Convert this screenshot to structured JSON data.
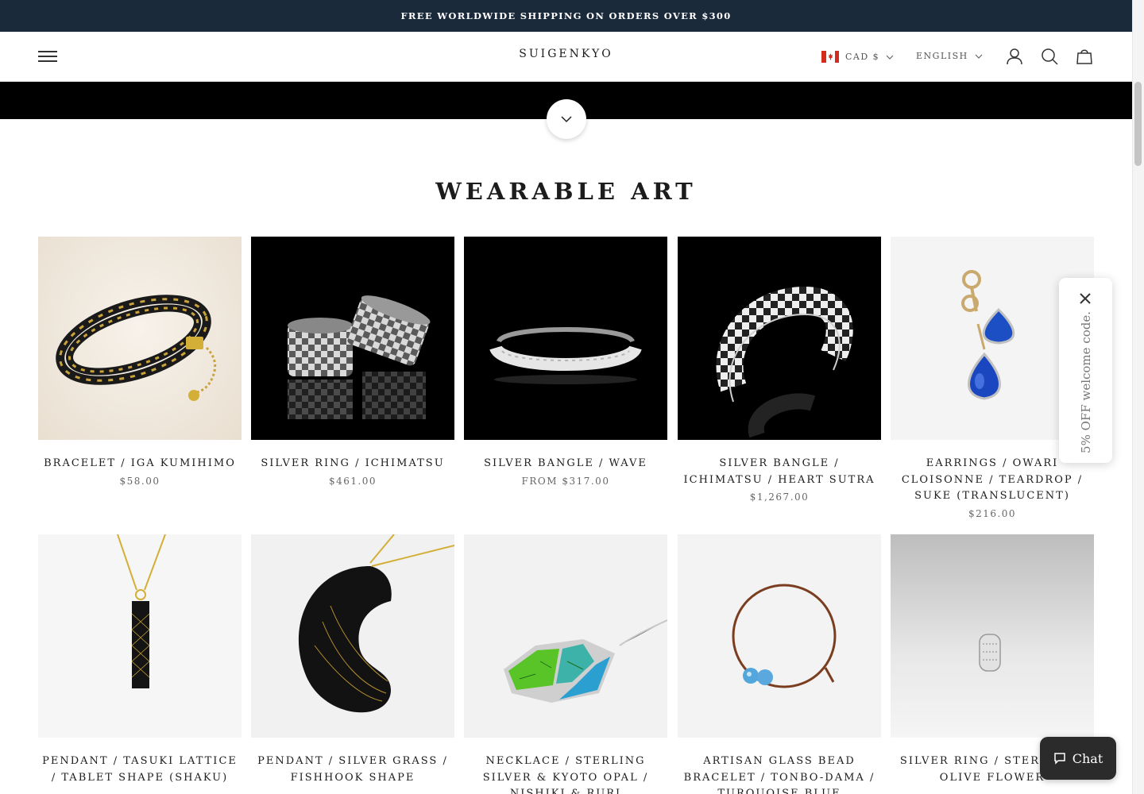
{
  "announcement": "FREE WORLDWIDE SHIPPING ON ORDERS OVER $300",
  "header": {
    "logo": "SUIGENKYO",
    "currency": "CAD $",
    "language": "ENGLISH"
  },
  "section": {
    "title": "WEARABLE ART"
  },
  "products": [
    {
      "title": "BRACELET / IGA KUMIHIMO",
      "price": "$58.00"
    },
    {
      "title": "SILVER RING / ICHIMATSU",
      "price": "$461.00"
    },
    {
      "title": "SILVER BANGLE / WAVE",
      "price": "FROM $317.00"
    },
    {
      "title": "SILVER BANGLE / ICHIMATSU / HEART SUTRA",
      "price": "$1,267.00"
    },
    {
      "title": "EARRINGS / OWARI CLOISONNE / TEARDROP / SUKE (TRANSLUCENT)",
      "price": "$216.00"
    },
    {
      "title": "PENDANT / TASUKI LATTICE / TABLET SHAPE (SHAKU)",
      "price": ""
    },
    {
      "title": "PENDANT / SILVER GRASS / FISHHOOK SHAPE",
      "price": ""
    },
    {
      "title": "NECKLACE / STERLING SILVER & KYOTO OPAL / NISHIKI & RURI",
      "price": ""
    },
    {
      "title": "ARTISAN GLASS BEAD BRACELET / TONBO-DAMA / TURQUOISE BLUE",
      "price": ""
    },
    {
      "title": "SILVER RING / STERLING / OLIVE FLOWER",
      "price": ""
    }
  ],
  "popup": {
    "text": "5% OFF welcome code."
  },
  "chat": {
    "label": "Chat"
  }
}
